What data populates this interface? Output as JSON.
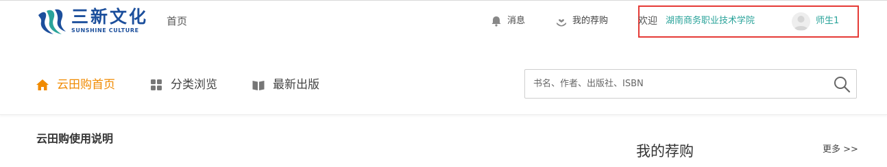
{
  "logo": {
    "cn": "三新文化",
    "en": "SUNSHINE CULTURE"
  },
  "header": {
    "home_label": "首页",
    "messages_label": "消息",
    "my_purchase_label": "我的荐购",
    "welcome_label": "欢迎",
    "school_name": "湖南商务职业技术学院",
    "username": "师生1"
  },
  "nav": {
    "items": [
      {
        "label": "云田购首页",
        "icon": "home-icon",
        "active": true
      },
      {
        "label": "分类浏览",
        "icon": "grid-icon",
        "active": false
      },
      {
        "label": "最新出版",
        "icon": "book-icon",
        "active": false
      }
    ]
  },
  "search": {
    "placeholder": "书名、作者、出版社、ISBN",
    "value": ""
  },
  "main": {
    "section_title": "云田购使用说明"
  },
  "side": {
    "title": "我的荐购",
    "more_label": "更多 >>"
  },
  "colors": {
    "accent": "#f08a00",
    "link": "#2aa39a",
    "brand": "#1c4f9c",
    "highlight_border": "#e53935"
  }
}
